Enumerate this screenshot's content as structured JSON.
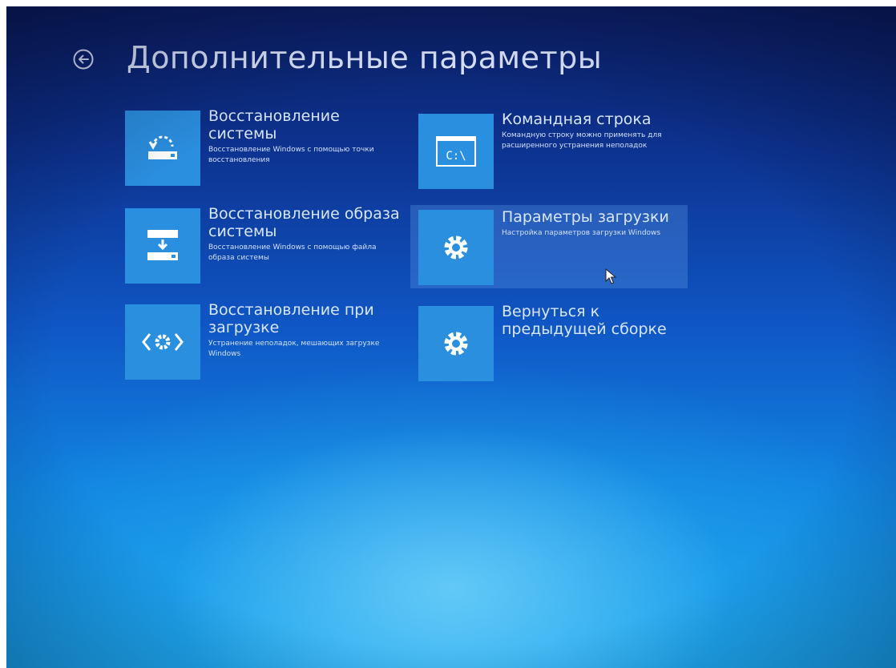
{
  "header": {
    "title": "Дополнительные параметры",
    "back_icon": "back-arrow-circle-icon"
  },
  "options": [
    {
      "title": "Восстановление системы",
      "description": "Восстановление Windows с помощью точки восстановления",
      "icon": "system-restore-icon"
    },
    {
      "title": "Восстановление образа системы",
      "description": "Восстановление Windows с помощью файла образа системы",
      "icon": "system-image-icon"
    },
    {
      "title": "Восстановление при загрузке",
      "description": "Устранение неполадок, мешающих загрузке Windows",
      "icon": "startup-repair-icon"
    },
    {
      "title": "Командная строка",
      "description": "Командную строку можно применять для расширенного устранения неполадок",
      "icon": "command-prompt-icon",
      "icon_text": "C:\\"
    },
    {
      "title": "Параметры загрузки",
      "description": "Настройка параметров загрузки Windows",
      "icon": "gear-icon",
      "selected": true
    },
    {
      "title": "Вернуться к предыдущей сборке",
      "description": "",
      "icon": "gear-icon"
    }
  ],
  "colors": {
    "tile": "#2b8fe0",
    "background_top": "#0b1e63",
    "background_bottom": "#16a3ec",
    "text": "#d9e6ff"
  }
}
